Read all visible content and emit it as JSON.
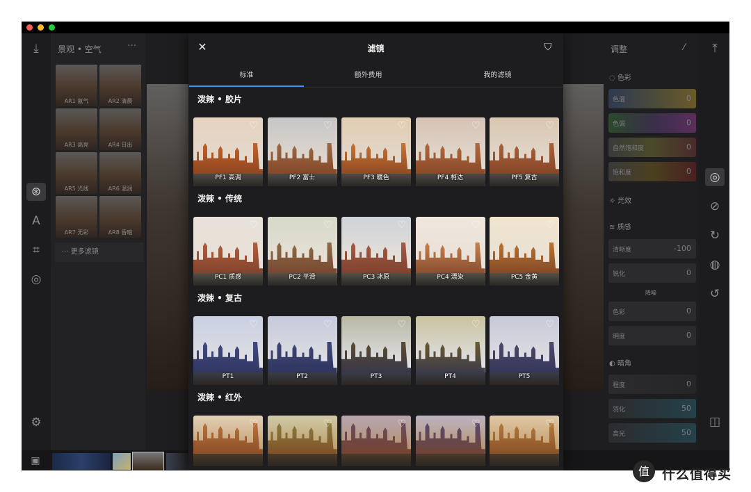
{
  "window": {
    "title_dots": [
      "close",
      "minimize",
      "maximize"
    ]
  },
  "left_panel": {
    "title": "景观 • 空气",
    "more_label": "···",
    "presets": [
      "AR1 氤气",
      "AR2 清晨",
      "AR3 高亮",
      "AR4 日出",
      "AR5 光线",
      "AR6 温润",
      "AR7 无彩",
      "AR8 昏暗"
    ],
    "more_filters": "··· 更多滤镜"
  },
  "modal": {
    "title": "滤镜",
    "tabs": [
      "标准",
      "额外费用",
      "我的滤镜"
    ],
    "groups": [
      {
        "title": "泼辣 • 胶片",
        "items": [
          "PF1 高调",
          "PF2 富士",
          "PF3 暖色",
          "PF4 柯达",
          "PF5 复古"
        ]
      },
      {
        "title": "泼辣 • 传统",
        "items": [
          "PC1 质感",
          "PC2 平滑",
          "PC3 冰原",
          "PC4 漂染",
          "PC5 金黄"
        ]
      },
      {
        "title": "泼辣 • 复古",
        "items": [
          "PT1",
          "PT2",
          "PT3",
          "PT4",
          "PT5"
        ]
      },
      {
        "title": "泼辣 • 红外",
        "items": [
          "",
          "",
          "",
          "",
          ""
        ]
      }
    ]
  },
  "right_panel": {
    "title": "调整",
    "sections": {
      "color": "色彩",
      "light": "光效",
      "texture": "质感",
      "noise": "降噪",
      "vignette": "暗角"
    },
    "sliders": [
      {
        "label": "色温",
        "value": "0"
      },
      {
        "label": "色调",
        "value": "0"
      },
      {
        "label": "自然饱和度",
        "value": "0"
      },
      {
        "label": "饱和度",
        "value": "0"
      },
      {
        "label": "清晰度",
        "value": "-100"
      },
      {
        "label": "锐化",
        "value": "0"
      },
      {
        "label": "色彩",
        "value": "0"
      },
      {
        "label": "明度",
        "value": "0"
      },
      {
        "label": "程度",
        "value": "0"
      },
      {
        "label": "羽化",
        "value": "50"
      },
      {
        "label": "高光",
        "value": "50"
      }
    ]
  },
  "watermark": {
    "text": "什么值得买"
  },
  "colors": {
    "accent": "#3d8ff0",
    "bg": "#1d1d1f"
  }
}
